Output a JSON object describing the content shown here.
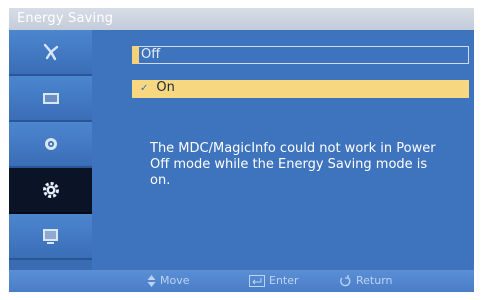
{
  "window": {
    "title": "Energy Saving"
  },
  "sidebar": {
    "items": [
      {
        "icon": "antenna-icon",
        "active": false
      },
      {
        "icon": "picture-icon",
        "active": false
      },
      {
        "icon": "sound-icon",
        "active": false
      },
      {
        "icon": "setup-gear-icon",
        "active": true
      },
      {
        "icon": "input-icon",
        "active": false
      }
    ]
  },
  "options": [
    {
      "label": "Off",
      "selected": false,
      "highlighted": false
    },
    {
      "label": "On",
      "selected": true,
      "highlighted": true
    }
  ],
  "check_mark": "✓",
  "message": "The MDC/MagicInfo could not work in Power Off mode while the Energy Saving mode is on.",
  "footer": {
    "move": "Move",
    "enter": "Enter",
    "return": "Return"
  },
  "colors": {
    "background": "#3e73bd",
    "highlight": "#f7d77f",
    "active_sidebar": "#0b1426"
  }
}
